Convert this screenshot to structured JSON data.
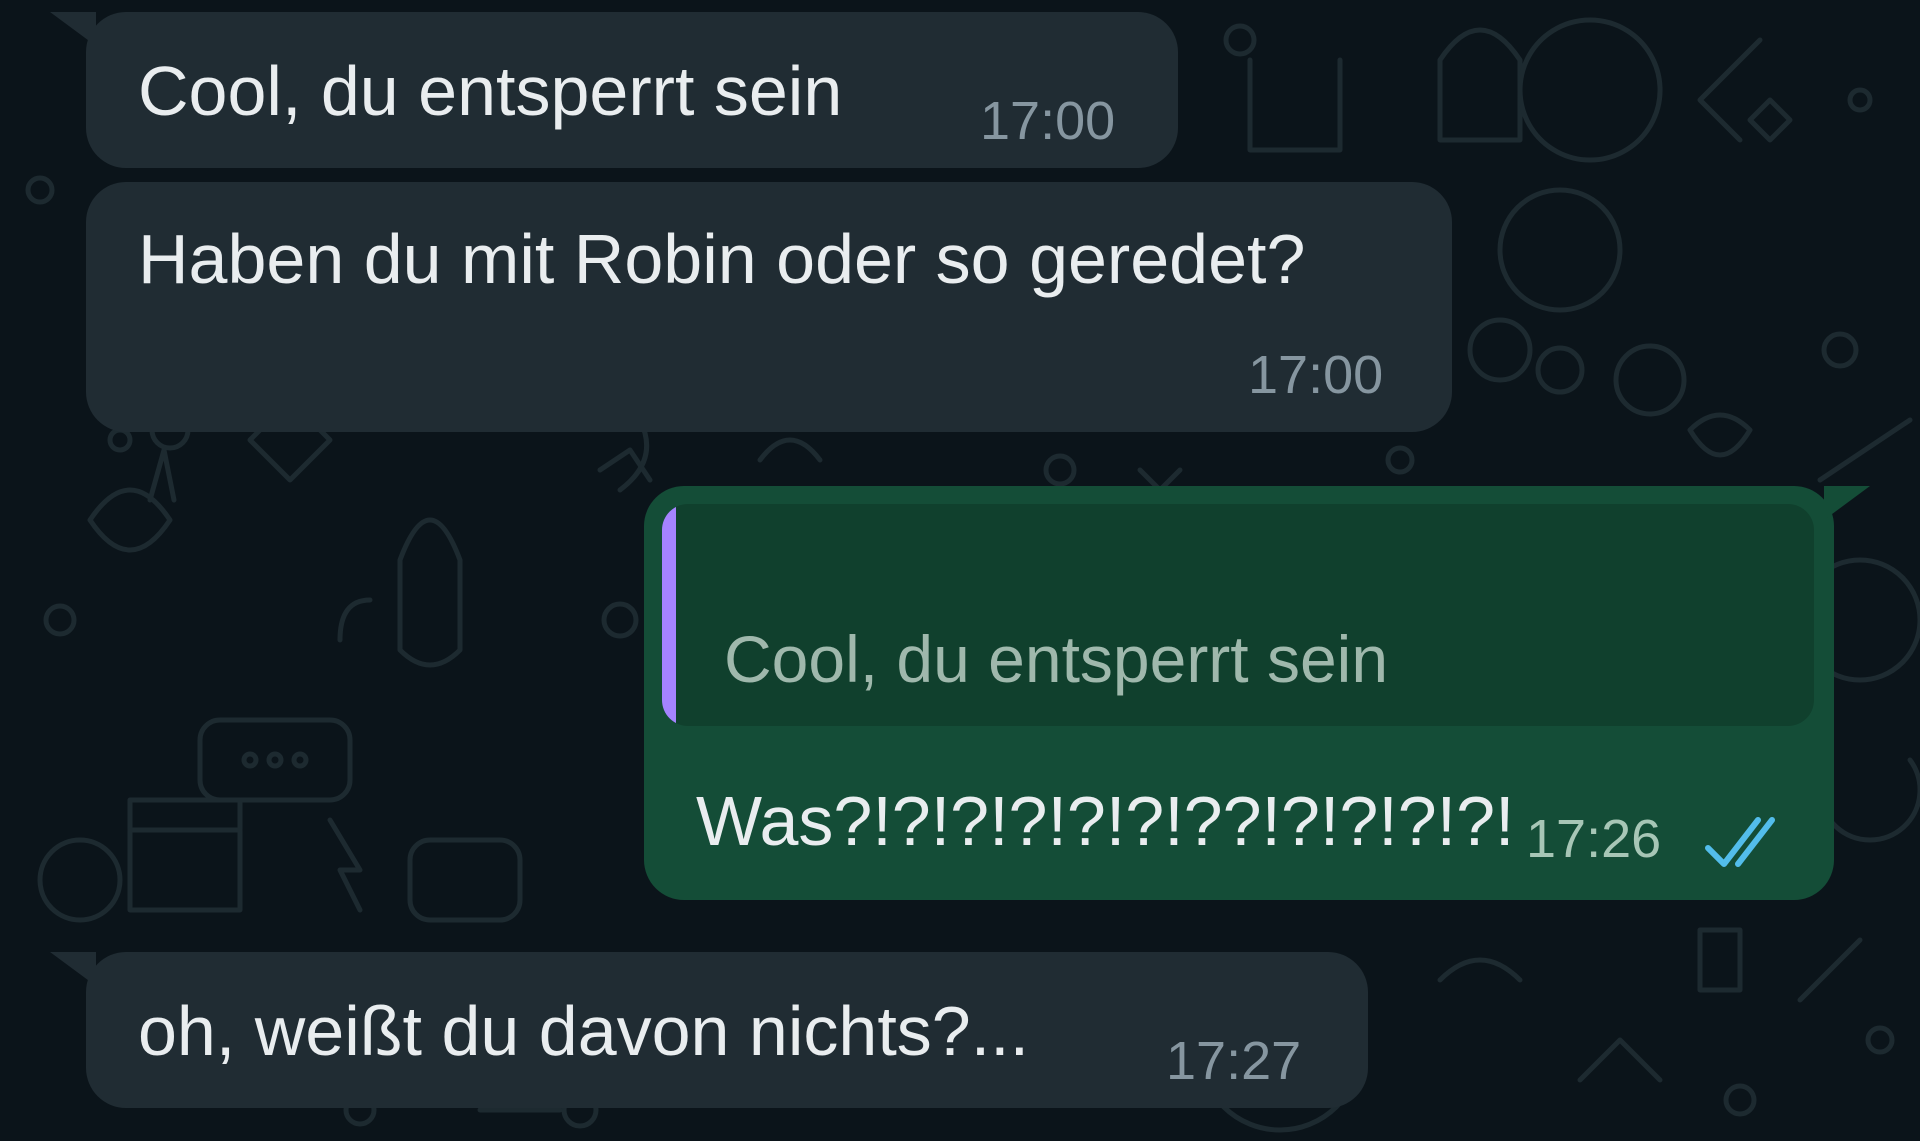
{
  "messages": [
    {
      "direction": "incoming",
      "text": "Cool, du entsperrt sein",
      "time": "17:00"
    },
    {
      "direction": "incoming",
      "text": "Haben du mit Robin oder so geredet?",
      "time": "17:00"
    },
    {
      "direction": "outgoing",
      "reply_to": "Cool, du entsperrt sein",
      "text": "Was?!?!?!?!?!?!??!?!?!?!?!",
      "time": "17:26",
      "status": "read",
      "status_icon": "double-check-icon"
    },
    {
      "direction": "incoming",
      "text": "oh, weißt du davon nichts?...",
      "time": "17:27"
    }
  ],
  "colors": {
    "background": "#0b141a",
    "incoming_bubble": "#202c33",
    "outgoing_bubble": "#144d37",
    "quote_accent": "#a583ff",
    "read_ticks": "#53bdeb"
  }
}
